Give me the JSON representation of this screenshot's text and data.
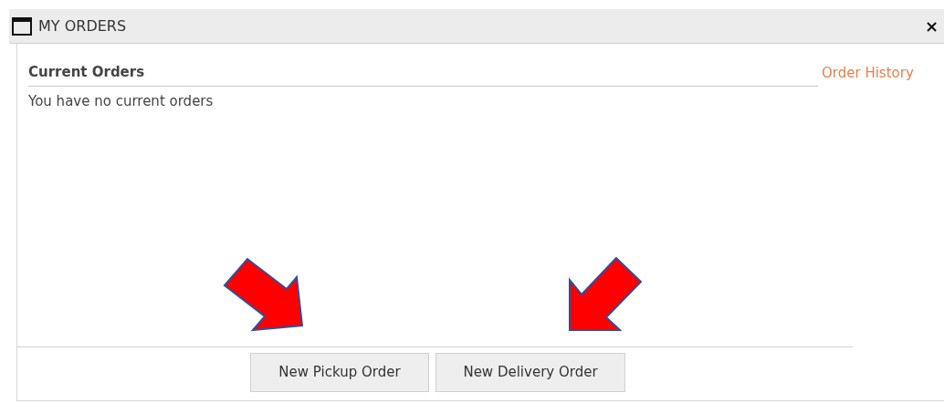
{
  "window": {
    "title": "MY ORDERS",
    "close": "×"
  },
  "section": {
    "title": "Current Orders",
    "link": "Order History",
    "message": "You have no current orders"
  },
  "buttons": [
    "New Pickup Order",
    "New Delivery Order"
  ],
  "annotations": [
    {
      "kind": "arrow-down-right"
    },
    {
      "kind": "arrow-down-left"
    }
  ]
}
